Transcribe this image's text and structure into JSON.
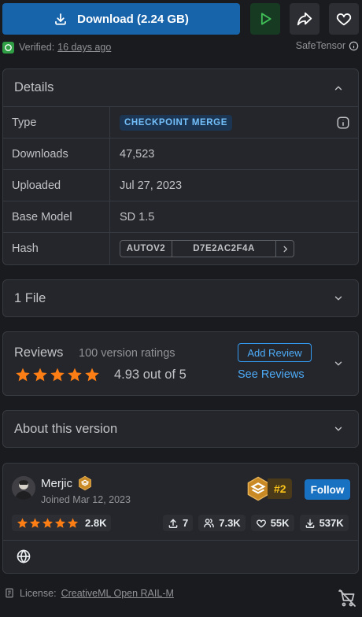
{
  "download": {
    "label": "Download (2.24 GB)"
  },
  "verified": {
    "label": "Verified:",
    "date": "16 days ago",
    "format": "SafeTensor"
  },
  "details": {
    "title": "Details",
    "rows": [
      {
        "label": "Type",
        "value": "CHECKPOINT MERGE"
      },
      {
        "label": "Downloads",
        "value": "47,523"
      },
      {
        "label": "Uploaded",
        "value": "Jul 27, 2023"
      },
      {
        "label": "Base Model",
        "value": "SD 1.5"
      },
      {
        "label": "Hash",
        "hash_type": "AUTOV2",
        "hash_value": "D7E2AC2F4A"
      }
    ]
  },
  "files": {
    "title": "1 File"
  },
  "reviews": {
    "title": "Reviews",
    "count": "100 version ratings",
    "score": "4.93 out of 5",
    "rating": 4.93,
    "add_label": "Add Review",
    "see_label": "See Reviews"
  },
  "about": {
    "title": "About this version"
  },
  "creator": {
    "name": "Merjic",
    "joined": "Joined Mar 12, 2023",
    "rank": "#2",
    "follow_label": "Follow",
    "star_stat": "2.8K",
    "uploads": "7",
    "followers": "7.3K",
    "likes": "55K",
    "downloads": "537K"
  },
  "license": {
    "label": "License:",
    "name": "CreativeML Open RAIL-M"
  },
  "colors": {
    "accent": "#1864ab",
    "star": "#fd7e14",
    "link": "#4dabf7",
    "rank": "#fcc419"
  }
}
